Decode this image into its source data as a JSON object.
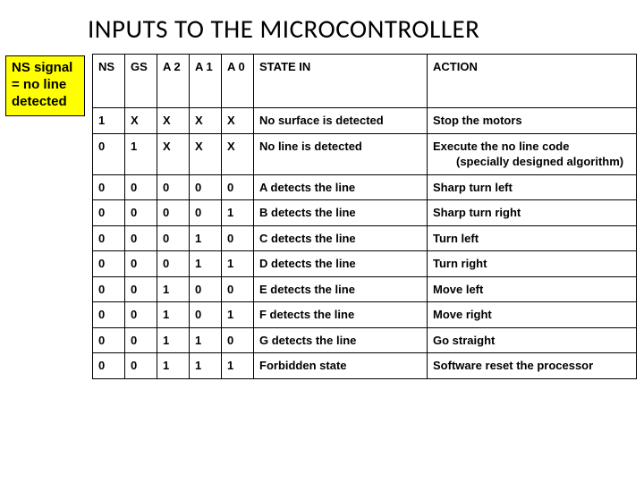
{
  "title": "INPUTS TO THE MICROCONTROLLER",
  "note": "NS signal = no line detected",
  "headers": {
    "c0": "NS",
    "c1": "GS",
    "c2": "A 2",
    "c3": "A 1",
    "c4": "A 0",
    "c5": "STATE IN",
    "c6": "ACTION"
  },
  "rows": [
    {
      "c0": "1",
      "c1": "X",
      "c2": "X",
      "c3": "X",
      "c4": "X",
      "c5": "No surface is detected",
      "c6": "Stop the motors"
    },
    {
      "c0": "0",
      "c1": "1",
      "c2": "X",
      "c3": "X",
      "c4": "X",
      "c5": "No line is detected",
      "c6": "Execute the no line code (specially designed algorithm)",
      "indent": true
    },
    {
      "c0": "0",
      "c1": "0",
      "c2": "0",
      "c3": "0",
      "c4": "0",
      "c5": "A detects the line",
      "c6": "Sharp turn left"
    },
    {
      "c0": "0",
      "c1": "0",
      "c2": "0",
      "c3": "0",
      "c4": "1",
      "c5": "B detects the line",
      "c6": "Sharp turn right"
    },
    {
      "c0": "0",
      "c1": "0",
      "c2": "0",
      "c3": "1",
      "c4": "0",
      "c5": "C detects the line",
      "c6": "Turn left"
    },
    {
      "c0": "0",
      "c1": "0",
      "c2": "0",
      "c3": "1",
      "c4": "1",
      "c5": "D detects the line",
      "c6": "Turn right"
    },
    {
      "c0": "0",
      "c1": "0",
      "c2": "1",
      "c3": "0",
      "c4": "0",
      "c5": "E detects the line",
      "c6": "Move left"
    },
    {
      "c0": "0",
      "c1": "0",
      "c2": "1",
      "c3": "0",
      "c4": "1",
      "c5": "F detects the line",
      "c6": "Move right"
    },
    {
      "c0": "0",
      "c1": "0",
      "c2": "1",
      "c3": "1",
      "c4": "0",
      "c5": "G detects the line",
      "c6": "Go straight"
    },
    {
      "c0": "0",
      "c1": "0",
      "c2": "1",
      "c3": "1",
      "c4": "1",
      "c5": "Forbidden state",
      "c6": "Software reset the processor",
      "justify": true
    }
  ]
}
